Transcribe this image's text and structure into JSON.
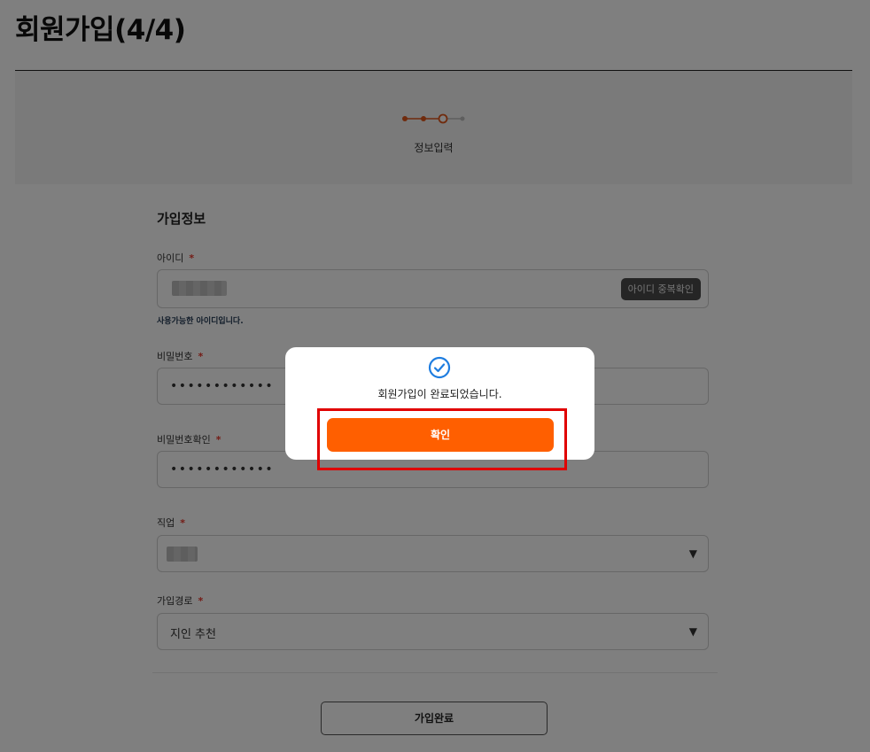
{
  "header": {
    "title": "회원가입(4/4)"
  },
  "stepper": {
    "label": "정보입력",
    "total_steps": 4,
    "current_step": 3,
    "accent": "#e0561b"
  },
  "form": {
    "section_title": "가입정보",
    "required_mark": "*",
    "id_field": {
      "label": "아이디",
      "check_button": "아이디 중복확인",
      "hint": "사용가능한 아이디입니다."
    },
    "password": {
      "label": "비밀번호",
      "masked_value": "••••••••••••"
    },
    "password_confirm": {
      "label": "비밀번호확인",
      "masked_value": "••••••••••••"
    },
    "job": {
      "label": "직업"
    },
    "referral": {
      "label": "가입경로",
      "selected": "지인 추천"
    },
    "select_caret": "▼",
    "submit_label": "가입완료"
  },
  "modal": {
    "icon": "check-circle-icon",
    "message": "회원가입이 완료되었습니다.",
    "confirm_label": "확인",
    "confirm_color": "#ff5f00"
  },
  "highlight_color": "#e00000"
}
